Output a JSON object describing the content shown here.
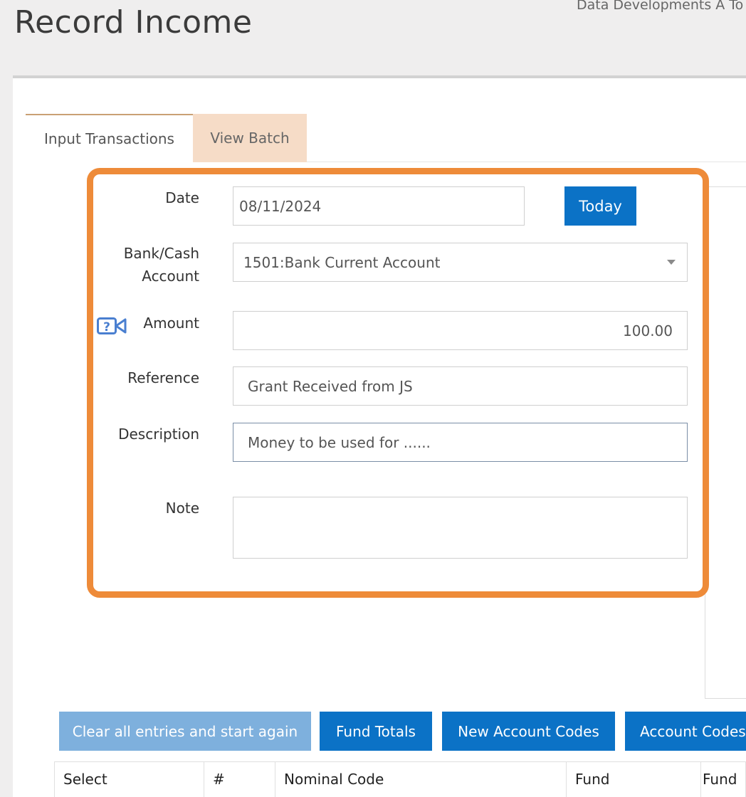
{
  "header": {
    "title": "Record Income",
    "org_name": "Data Developments A To"
  },
  "tabs": [
    {
      "label": "Input Transactions",
      "active": true
    },
    {
      "label": "View Batch",
      "active": false
    }
  ],
  "form": {
    "date": {
      "label": "Date",
      "value": "08/11/2024",
      "today_label": "Today"
    },
    "bank_account": {
      "label_line1": "Bank/Cash",
      "label_line2": "Account",
      "value": "1501:Bank Current Account"
    },
    "amount": {
      "label": "Amount",
      "value": "100.00",
      "help_icon": "video-help-icon"
    },
    "reference": {
      "label": "Reference",
      "value": "Grant Received from JS"
    },
    "description": {
      "label": "Description",
      "value": "Money to be used for ......"
    },
    "note": {
      "label": "Note",
      "value": ""
    }
  },
  "actions": {
    "clear": "Clear all entries and start again",
    "fund_totals": "Fund Totals",
    "new_account_codes": "New Account Codes",
    "account_codes": "Account Codes"
  },
  "table": {
    "columns": [
      "Select",
      "#",
      "Nominal Code",
      "Fund",
      "Fund"
    ]
  },
  "colors": {
    "accent": "#0b72c6",
    "highlight": "#ee8b39",
    "tab_inactive": "#f6dcc7",
    "disabled_button": "#7eb0dd"
  }
}
